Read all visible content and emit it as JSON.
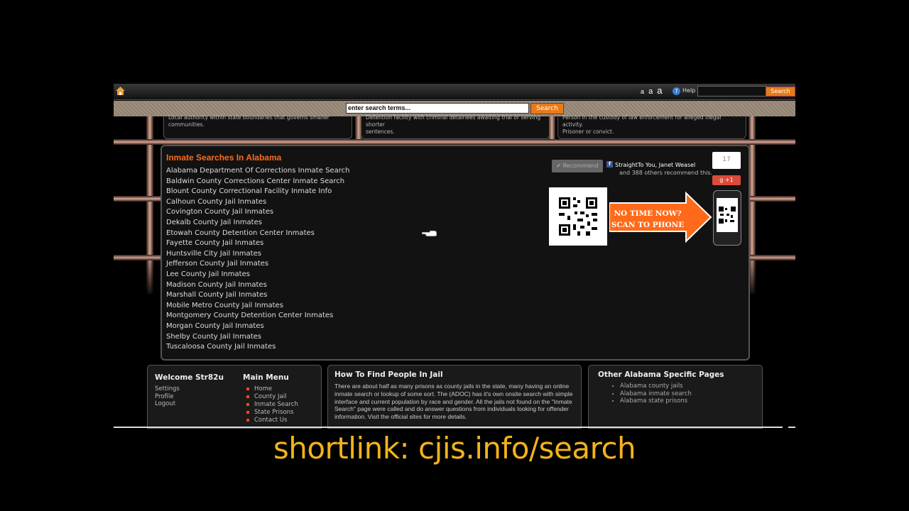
{
  "topbar": {
    "font_sizes": [
      "a",
      "a",
      "a"
    ],
    "help_label": "Help",
    "search_value": "",
    "search_button": "Search"
  },
  "main_search": {
    "value": "enter search terms...",
    "button": "Search"
  },
  "info_boxes": [
    {
      "text_line1": "Local authority within state boundaries that governs smaller",
      "text_line2": "communities."
    },
    {
      "text_line1": "Detention facility with criminal detainees awaiting trial or serving shorter",
      "text_line2": "sentences."
    },
    {
      "text_line1": "Person in the custody of law enforcement for alleged illegal activity.",
      "text_line2": "Prisoner or convict."
    }
  ],
  "inmate_section": {
    "title": "Inmate Searches In Alabama",
    "items": [
      "Alabama Department Of Corrections Inmate Search",
      "Baldwin County Corrections Center Inmate Search",
      "Blount County Correctional Facility Inmate Info",
      "Calhoun County Jail Inmates",
      "Covington County Jail Inmates",
      "Dekalb County Jail Inmates",
      "Etowah County Detention Center Inmates",
      "Fayette County Jail Inmates",
      "Huntsville City Jail Inmates",
      "Jefferson County Jail Inmates",
      "Lee County Jail Inmates",
      "Madison County Jail Inmates",
      "Marshall County Jail Inmates",
      "Mobile Metro County Jail Inmates",
      "Montgomery County Detention Center Inmates",
      "Morgan County Jail Inmates",
      "Shelby County Jail Inmates",
      "Tuscaloosa County Jail Inmates"
    ]
  },
  "social": {
    "recommend_label": "Recommend",
    "fb_names": "StraightTo You, Janet Weasel",
    "fb_others": "and 388 others recommend this.",
    "gplus_count": "17",
    "gplus_label": "+1",
    "scan_text_line1": "NO TIME NOW?",
    "scan_text_line2": "SCAN TO PHONE"
  },
  "welcome_panel": {
    "title": "Welcome Str82u",
    "links": [
      "Settings",
      "Profile",
      "Logout"
    ],
    "menu_title": "Main Menu",
    "menu_items": [
      "Home",
      "County Jail",
      "Inmate Search",
      "State Prisons",
      "Contact Us"
    ]
  },
  "howto_panel": {
    "title": "How To Find People In Jail",
    "text": "There are about half as many prisons as county jails in the state, many having an online inmate search or lookup of some sort. The (ADOC) has it's own onsite search with simple interface and current population by race and gender. All the jails not found on the \"Inmate Search\" page were called and do answer questions from individuals looking for offender information. Visit the official sites for more details."
  },
  "other_panel": {
    "title": "Other Alabama Specific Pages",
    "items": [
      "Alabama county jails",
      "Alabama inmate search",
      "Alabama state prisons"
    ]
  },
  "caption": "shortlink: cjis.info/search",
  "colors": {
    "accent": "#ff6a1a",
    "button": "#e87a1a",
    "caption": "#f2b31c"
  }
}
